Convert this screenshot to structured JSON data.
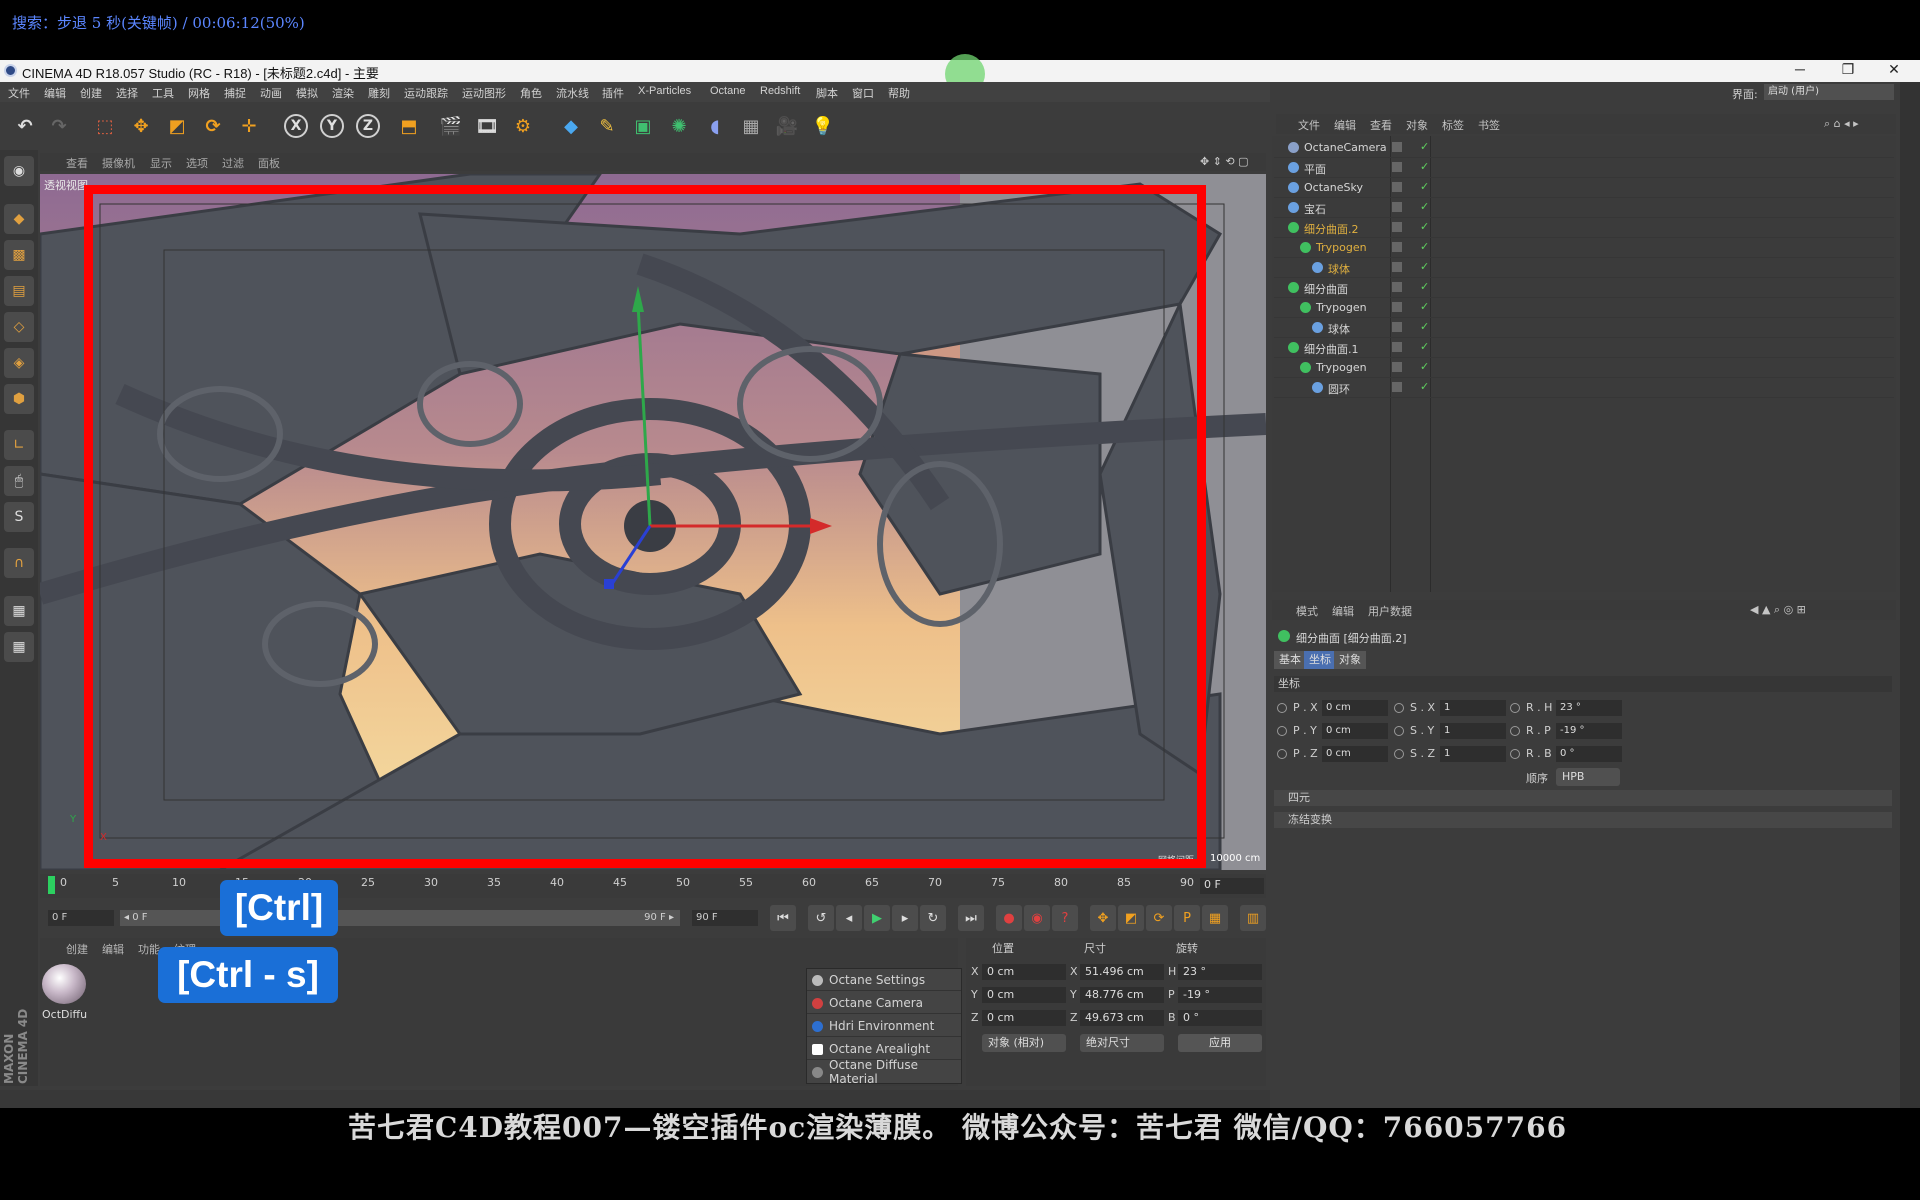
{
  "overlay": {
    "search_line": "搜索：步退 5 秒(关键帧) / 00:06:12(50%)",
    "ctrl_key": "[Ctrl]",
    "ctrl_s_key": "[Ctrl - s]",
    "subtitle": "苦七君C4D教程007—镂空插件oc渲染薄膜。  微博公众号：苦七君  微信/QQ：766057766"
  },
  "window": {
    "title": "CINEMA 4D R18.057 Studio (RC - R18) - [未标题2.c4d] - 主要",
    "minimize": "─",
    "maximize": "❐",
    "close": "✕"
  },
  "menu": [
    "文件",
    "编辑",
    "创建",
    "选择",
    "工具",
    "网格",
    "捕捉",
    "动画",
    "模拟",
    "渲染",
    "雕刻",
    "运动跟踪",
    "运动图形",
    "角色",
    "流水线",
    "插件",
    "X-Particles",
    "Octane",
    "Redshift",
    "脚本",
    "窗口",
    "帮助"
  ],
  "interface": {
    "label": "界面:",
    "value": "启动 (用户)"
  },
  "viewport": {
    "menu": [
      "查看",
      "摄像机",
      "显示",
      "选项",
      "过滤",
      "面板"
    ],
    "label": "透视视图",
    "grid_label": "网格间距",
    "scale": "10000 cm"
  },
  "timeline": {
    "ticks": [
      "0",
      "5",
      "10",
      "15",
      "20",
      "25",
      "30",
      "35",
      "40",
      "45",
      "50",
      "55",
      "60",
      "65",
      "70",
      "75",
      "80",
      "85",
      "90"
    ],
    "current_frame": "0 F",
    "start_field": "0 F",
    "range_start": "◂ 0 F",
    "range_end": "90 F ▸",
    "end_field": "90 F"
  },
  "materials": {
    "menu": [
      "创建",
      "编辑",
      "功能",
      "纹理"
    ],
    "item": "OctDiffu"
  },
  "octane_menu": [
    "Octane Settings",
    "Octane Camera",
    "Hdri Environment",
    "Octane Arealight",
    "Octane Diffuse Material"
  ],
  "octane_colors": [
    "#bbbbbb",
    "#d04040",
    "#2d6fd0",
    "#ffffff",
    "#888888"
  ],
  "coordinates": {
    "headers": [
      "位置",
      "尺寸",
      "旋转"
    ],
    "rows": [
      {
        "axis": "X",
        "pos": "0 cm",
        "size_axis": "X",
        "size": "51.496 cm",
        "rot_axis": "H",
        "rot": "23 °"
      },
      {
        "axis": "Y",
        "pos": "0 cm",
        "size_axis": "Y",
        "size": "48.776 cm",
        "rot_axis": "P",
        "rot": "-19 °"
      },
      {
        "axis": "Z",
        "pos": "0 cm",
        "size_axis": "Z",
        "size": "49.673 cm",
        "rot_axis": "B",
        "rot": "0 °"
      }
    ],
    "mode_dropdown": "对象 (相对)",
    "size_dropdown": "绝对尺寸",
    "apply": "应用"
  },
  "brand": "MAXON CINEMA 4D",
  "object_manager": {
    "menu": [
      "文件",
      "编辑",
      "查看",
      "对象",
      "标签",
      "书签"
    ],
    "objects": [
      {
        "name": "OctaneCamera",
        "color": "#d6d6d6",
        "icon": "#8aa0c8",
        "indent": 0
      },
      {
        "name": "平面",
        "color": "#d6d6d6",
        "icon": "#6aa0e0",
        "indent": 0
      },
      {
        "name": "OctaneSky",
        "color": "#d6d6d6",
        "icon": "#6aa0e0",
        "indent": 0
      },
      {
        "name": "宝石",
        "color": "#d6d6d6",
        "icon": "#6aa0e0",
        "indent": 0
      },
      {
        "name": "细分曲面.2",
        "color": "#e0b040",
        "icon": "#40c060",
        "indent": 0
      },
      {
        "name": "Trypogen",
        "color": "#e0b040",
        "icon": "#40c060",
        "indent": 1
      },
      {
        "name": "球体",
        "color": "#e0b040",
        "icon": "#6aa0e0",
        "indent": 2
      },
      {
        "name": "细分曲面",
        "color": "#d6d6d6",
        "icon": "#40c060",
        "indent": 0
      },
      {
        "name": "Trypogen",
        "color": "#d6d6d6",
        "icon": "#40c060",
        "indent": 1
      },
      {
        "name": "球体",
        "color": "#d6d6d6",
        "icon": "#6aa0e0",
        "indent": 2
      },
      {
        "name": "细分曲面.1",
        "color": "#d6d6d6",
        "icon": "#40c060",
        "indent": 0
      },
      {
        "name": "Trypogen",
        "color": "#d6d6d6",
        "icon": "#40c060",
        "indent": 1
      },
      {
        "name": "圆环",
        "color": "#d6d6d6",
        "icon": "#6aa0e0",
        "indent": 2
      }
    ]
  },
  "attribute_manager": {
    "menu": [
      "模式",
      "编辑",
      "用户数据"
    ],
    "title": "细分曲面 [细分曲面.2]",
    "tabs": [
      "基本",
      "坐标",
      "对象"
    ],
    "active_tab": 1,
    "section": "坐标",
    "rows": [
      {
        "pl": "P . X",
        "pv": "0 cm",
        "sl": "S . X",
        "sv": "1",
        "rl": "R . H",
        "rv": "23 °"
      },
      {
        "pl": "P . Y",
        "pv": "0 cm",
        "sl": "S . Y",
        "sv": "1",
        "rl": "R . P",
        "rv": "-19 °"
      },
      {
        "pl": "P . Z",
        "pv": "0 cm",
        "sl": "S . Z",
        "sv": "1",
        "rl": "R . B",
        "rv": "0 °"
      }
    ],
    "order_label": "顺序",
    "order_value": "HPB",
    "collapsed": [
      "四元",
      "冻结变换"
    ]
  }
}
